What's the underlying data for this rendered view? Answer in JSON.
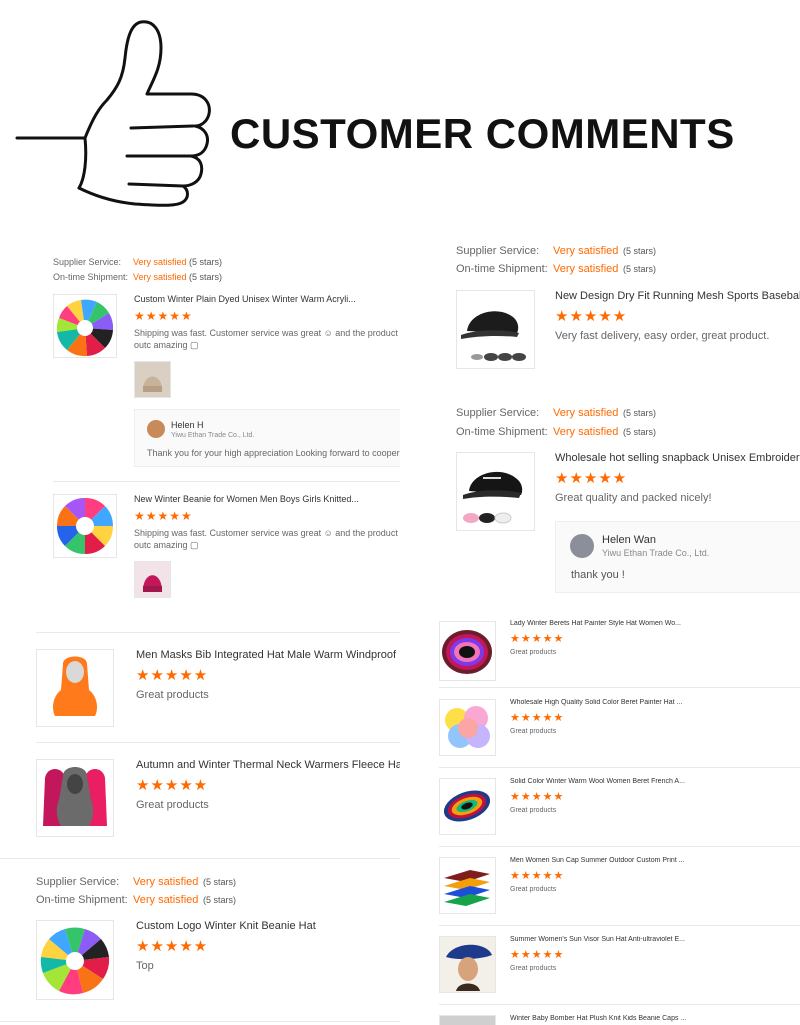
{
  "header": {
    "title": "CUSTOMER COMMENTS"
  },
  "colors": {
    "accent": "#ff6a00",
    "text": "#333333",
    "muted": "#666666",
    "divider": "#e9e9e9"
  },
  "rating_glyphs": "★★★★★",
  "left_panel_1": {
    "supplier_label": "Supplier Service:",
    "supplier_value": "Very satisfied",
    "supplier_stars": "(5 stars)",
    "shipment_label": "On-time Shipment:",
    "shipment_value": "Very satisfied",
    "shipment_stars": "(5 stars)",
    "review_1": {
      "title": "Custom Winter Plain Dyed Unisex Winter Warm Acryli...",
      "text": "Shipping was fast. Customer service was great ☺ and the product outc amazing ▢",
      "reply": {
        "name": "Helen H",
        "company": "Yiwu Ethan Trade Co., Ltd.",
        "text": "Thank you for your high appreciation Looking forward to cooperate w"
      }
    },
    "review_2": {
      "title": "New Winter Beanie for Women Men Boys Girls Knitted...",
      "text": "Shipping was fast. Customer service was great ☺ and the product outc amazing ▢"
    }
  },
  "right_panel_1": {
    "supplier_label": "Supplier Service:",
    "supplier_value": "Very satisfied",
    "supplier_stars": "(5 stars)",
    "shipment_label": "On-time Shipment:",
    "shipment_value": "Very satisfied",
    "shipment_stars": "(5 stars)",
    "review": {
      "title": "New Design Dry Fit Running Mesh Sports Baseball C",
      "text": "Very fast delivery, easy order, great product."
    }
  },
  "right_panel_2": {
    "supplier_label": "Supplier Service:",
    "supplier_value": "Very satisfied",
    "supplier_stars": "(5 stars)",
    "shipment_label": "On-time Shipment:",
    "shipment_value": "Very satisfied",
    "shipment_stars": "(5 stars)",
    "review": {
      "title": "Wholesale hot selling snapback Unisex Embroidery Y",
      "text": "Great quality and packed nicely!",
      "reply": {
        "name": "Helen Wan",
        "company": "Yiwu Ethan Trade Co., Ltd.",
        "text": "thank  you !"
      }
    }
  },
  "left_panel_2": {
    "items": [
      {
        "title": "Men Masks Bib Integrated Hat Male Warm Windproof ...",
        "text": "Great products"
      },
      {
        "title": "Autumn and Winter Thermal Neck Warmers Fleece Ha...",
        "text": "Great products"
      }
    ]
  },
  "left_panel_3": {
    "supplier_label": "Supplier Service:",
    "supplier_value": "Very satisfied",
    "supplier_stars": "(5 stars)",
    "shipment_label": "On-time Shipment:",
    "shipment_value": "Very satisfied",
    "shipment_stars": "(5 stars)",
    "review": {
      "title": "Custom Logo Winter Knit Beanie Hat",
      "text": "Top"
    }
  },
  "right_list": {
    "items": [
      {
        "title": "Lady Winter Berets Hat Painter Style Hat Women Wo...",
        "text": "Great products"
      },
      {
        "title": "Wholesale High Quality Solid Color Beret Painter Hat ...",
        "text": "Great products"
      },
      {
        "title": "Solid Color Winter Warm Wool Women Beret French A...",
        "text": "Great products"
      },
      {
        "title": "Men Women Sun Cap Summer Outdoor Custom Print ...",
        "text": "Great products"
      },
      {
        "title": "Summer Women's Sun Visor Sun Hat Anti-ultraviolet E...",
        "text": "Great products"
      },
      {
        "title": "Winter Baby Bomber Hat Plush Knit Kids Beanie Caps ...",
        "text": ""
      }
    ]
  }
}
